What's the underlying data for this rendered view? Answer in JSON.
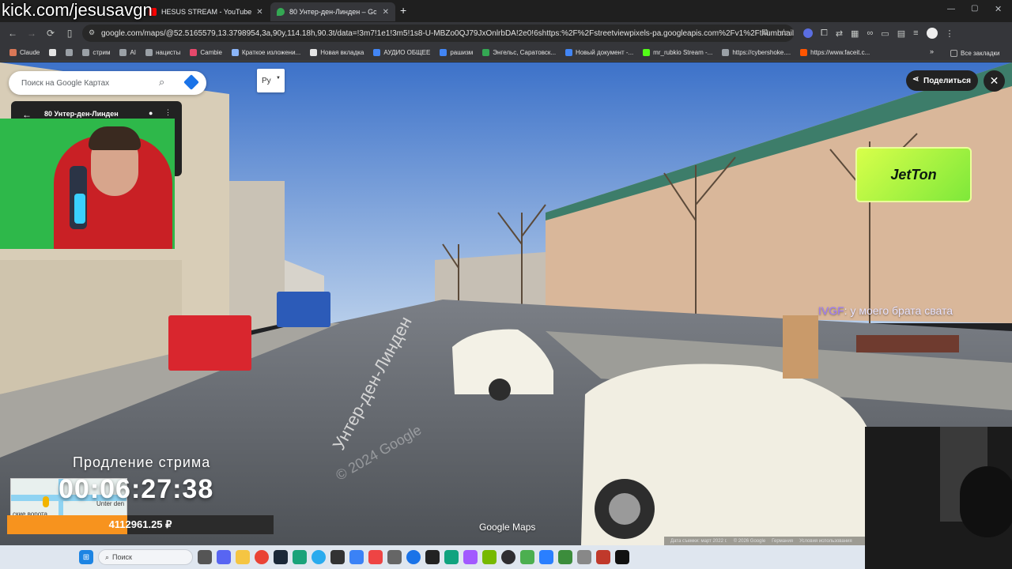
{
  "stream_handle": "kick.com/jesusavgn",
  "tabs": [
    {
      "label": "HESUS STREAM - YouTube",
      "active": false
    },
    {
      "label": "80 Унтер-ден-Линден – Googl",
      "active": true
    }
  ],
  "new_tab": "+",
  "address_bar": {
    "url": "google.com/maps/@52.5165579,13.3798954,3a,90y,114.18h,90.3t/data=!3m7!1e1!3m5!1s8-U-MBZo0QJ79JxOnlrbDA!2e0!6shttps:%2F%2Fstreetviewpixels-pa.googleapis.com%2Fv1%2Fthumbnail%3F..."
  },
  "bookmarks": [
    {
      "label": "Claude",
      "color": "#d97757"
    },
    {
      "label": "",
      "color": "#e3e3e3"
    },
    {
      "label": "",
      "color": "#9aa0a6"
    },
    {
      "label": "стрим",
      "color": "#9aa0a6"
    },
    {
      "label": "AI",
      "color": "#9aa0a6"
    },
    {
      "label": "нацисты",
      "color": "#9aa0a6"
    },
    {
      "label": "Cambie",
      "color": "#e5486b"
    },
    {
      "label": "Краткое изложени...",
      "color": "#8ab4f8"
    },
    {
      "label": "Новая вкладка",
      "color": "#e3e3e3"
    },
    {
      "label": "АУДИО ОБЩЕЕ",
      "color": "#4285f4"
    },
    {
      "label": "рашизм",
      "color": "#4285f4"
    },
    {
      "label": "Энгельс, Саратовск...",
      "color": "#34a853"
    },
    {
      "label": "Новый документ -...",
      "color": "#4285f4"
    },
    {
      "label": "mr_rubkio Stream -...",
      "color": "#53fc18"
    },
    {
      "label": "https://cybershoke....",
      "color": "#9aa0a6"
    },
    {
      "label": "https://www.faceit.c...",
      "color": "#ff5500"
    }
  ],
  "bookmarks_all": "Все закладки",
  "maps": {
    "search_placeholder": "Поиск на Google Картах",
    "place_name": "80 Унтер-ден-Линден",
    "language_button": "Рy",
    "share_label": "Поделиться",
    "google_maps_logo": "Google Maps",
    "street_label": "Унтер-ден-Линден",
    "watermark": "© 2024 Google",
    "footer": [
      "Дата съемки: март 2022 г.",
      "© 2026 Google",
      "Германия",
      "Условия использования"
    ]
  },
  "jetton_logo": "JetTon",
  "chat_message": {
    "user": "IVGF",
    "text": "у моего брата свата"
  },
  "stream_extension": {
    "label": "Продление стрима",
    "timer": "00:06:27:38",
    "amount": "4112961.25 ₽",
    "progress_fraction": 0.45
  },
  "minimap": {
    "labels": [
      "Unter den",
      "ские ворота"
    ]
  },
  "taskbar": {
    "search_label": "Поиск",
    "items": [
      "windows",
      "search",
      "folder",
      "discord",
      "explorer",
      "chrome",
      "steam",
      "edge",
      "telegram",
      "terminal",
      "arrow",
      "settings",
      "blue",
      "close",
      "chatgpt",
      "figma",
      "nvidia",
      "obs",
      "vpn",
      "green",
      "blue2",
      "gear",
      "red",
      "dark"
    ]
  }
}
